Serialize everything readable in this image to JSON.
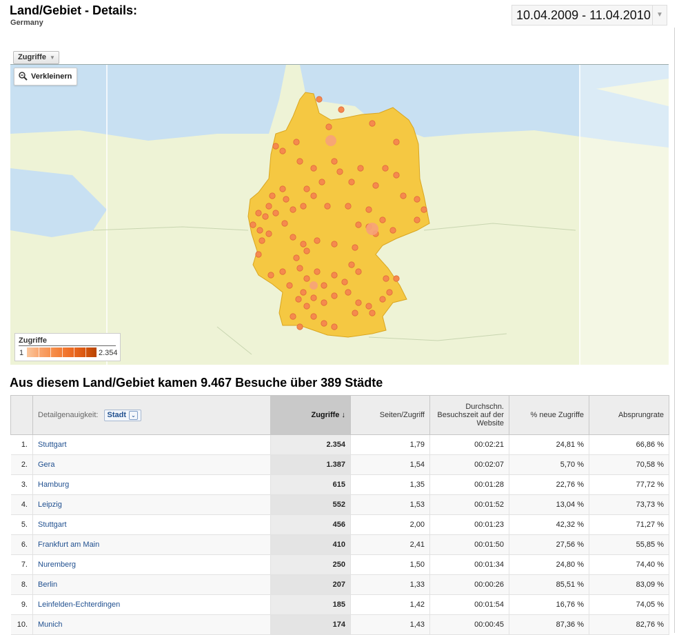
{
  "header": {
    "title": "Land/Gebiet - Details:",
    "subtitle": "Germany",
    "date_range": "10.04.2009 - 11.04.2010"
  },
  "map": {
    "metric_tab": "Zugriffe",
    "zoom_button": "Verkleinern",
    "legend": {
      "title": "Zugriffe",
      "min": "1",
      "max": "2.354"
    },
    "colors": {
      "sea": "#c8e0f2",
      "land": "#eef3d6",
      "country": "#f5c842",
      "dot": "#f58a4e"
    }
  },
  "summary": "Aus diesem Land/Gebiet kamen 9.467 Besuche über 389 Städte",
  "table": {
    "detail_label": "Detailgenauigkeit:",
    "dimension": "Stadt",
    "columns": [
      "Zugriffe",
      "Seiten/Zugriff",
      "Durchschn. Besuchszeit auf der Website",
      "% neue Zugriffe",
      "Absprungrate"
    ],
    "sort_arrow": "↓",
    "rows": [
      {
        "idx": "1.",
        "city": "Stuttgart",
        "visits": "2.354",
        "pages": "1,79",
        "time": "00:02:21",
        "new": "24,81 %",
        "bounce": "66,86 %"
      },
      {
        "idx": "2.",
        "city": "Gera",
        "visits": "1.387",
        "pages": "1,54",
        "time": "00:02:07",
        "new": "5,70 %",
        "bounce": "70,58 %"
      },
      {
        "idx": "3.",
        "city": "Hamburg",
        "visits": "615",
        "pages": "1,35",
        "time": "00:01:28",
        "new": "22,76 %",
        "bounce": "77,72 %"
      },
      {
        "idx": "4.",
        "city": "Leipzig",
        "visits": "552",
        "pages": "1,53",
        "time": "00:01:52",
        "new": "13,04 %",
        "bounce": "73,73 %"
      },
      {
        "idx": "5.",
        "city": "Stuttgart",
        "visits": "456",
        "pages": "2,00",
        "time": "00:01:23",
        "new": "42,32 %",
        "bounce": "71,27 %"
      },
      {
        "idx": "6.",
        "city": "Frankfurt am Main",
        "visits": "410",
        "pages": "2,41",
        "time": "00:01:50",
        "new": "27,56 %",
        "bounce": "55,85 %"
      },
      {
        "idx": "7.",
        "city": "Nuremberg",
        "visits": "250",
        "pages": "1,50",
        "time": "00:01:34",
        "new": "24,80 %",
        "bounce": "74,40 %"
      },
      {
        "idx": "8.",
        "city": "Berlin",
        "visits": "207",
        "pages": "1,33",
        "time": "00:00:26",
        "new": "85,51 %",
        "bounce": "83,09 %"
      },
      {
        "idx": "9.",
        "city": "Leinfelden-Echterdingen",
        "visits": "185",
        "pages": "1,42",
        "time": "00:01:54",
        "new": "16,76 %",
        "bounce": "74,05 %"
      },
      {
        "idx": "10.",
        "city": "Munich",
        "visits": "174",
        "pages": "1,43",
        "time": "00:00:45",
        "new": "87,36 %",
        "bounce": "82,76 %"
      }
    ]
  }
}
